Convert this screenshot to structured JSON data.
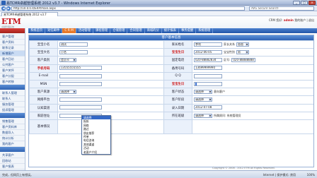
{
  "window": {
    "title": "易TCMR卓越管理系统 2012 v3.7 - Windows Internet Explorer",
    "buttons": [
      "_",
      "□",
      "×"
    ]
  },
  "browser": {
    "address": "http://10.0.0.4/ERP/main.aspx",
    "search_placeholder": "AVG Secure Search",
    "tab_label": "易TCMR卓越管理系统 2012 v3.7"
  },
  "app": {
    "logo": "ETM",
    "logo_sub": "卓越管理系统",
    "user_greeting": "CRM 您好:",
    "user_name": "admin",
    "user_links": "我的账户 | 退出"
  },
  "menu": [
    {
      "label": "系统首页",
      "active": false
    },
    {
      "label": "短信邮件",
      "active": false
    },
    {
      "label": "C R M",
      "active": true
    },
    {
      "label": "活动管理",
      "active": false
    },
    {
      "label": "课程管理",
      "active": false
    },
    {
      "label": "仓储管理",
      "active": false
    },
    {
      "label": "合同管理",
      "active": false
    },
    {
      "label": "商城的分",
      "active": false
    },
    {
      "label": "统计报表",
      "active": false
    },
    {
      "label": "事务提醒",
      "active": false
    },
    {
      "label": "系统管理",
      "active": false
    }
  ],
  "sidebar": {
    "items": [
      "客户管理",
      "客户资料",
      "联系记录",
      "新增客户",
      "客户回访",
      "公共客户",
      "客户关怀",
      "客户分配",
      "客户转移",
      "联系人管理",
      "联系人",
      "服务管理",
      "投诉管理",
      "销售管理",
      "客户资料库",
      "数据导入",
      "统计分析",
      "我的客户",
      "共享客户",
      "回收站",
      "客户报表",
      "客户设置",
      "设置"
    ]
  },
  "panel_title": "客户基本信息",
  "form": {
    "rows": [
      {
        "l1": "宝宝小名",
        "v1": "测试",
        "l2": "家长姓名",
        "v2": "李利",
        "v2_tail": "家长关系",
        "v2_sel": "爸爸"
      },
      {
        "l1": "宝宝大名",
        "v1": "小名",
        "l2": "宝宝生日",
        "v2": "2012-06-05",
        "v2_tail": "宝宝性别",
        "v2_sel": "男"
      },
      {
        "l1": "客户类别",
        "v1": "会员卡",
        "l2": "固定电话",
        "v2": "020-88882834",
        "v2_tail": "区号:",
        "v2_extra": "020-88888888"
      },
      {
        "l1": "手机号码",
        "v1": "13555555555",
        "l2": "备用号码",
        "v2": "13699999990"
      },
      {
        "l1": "E-mail",
        "v1": "",
        "l2": "Q Q",
        "v2": ""
      },
      {
        "l1": "MSN",
        "v1": "",
        "l2": "宝宝生日",
        "v2": ""
      },
      {
        "l1": "客户来源",
        "v1": "请选择",
        "l2": "客户状态",
        "v2": "请选择",
        "v2_tail": "意向客户"
      },
      {
        "l1": "网络平台",
        "v1": "",
        "l2": "客户阶段",
        "v2": "请选择"
      },
      {
        "l1": "认知渠道",
        "v1": "",
        "l2": "录入日期",
        "v2": "2012-07-08"
      },
      {
        "l1": "家庭住址",
        "v1": "",
        "l2": "所在班级",
        "v2": "请选择",
        "v2_tail": "所属顾问: 系统管理员"
      },
      {
        "l1": "基本情况",
        "v1": "",
        "l2": "",
        "v2": ""
      }
    ]
  },
  "dropdown": {
    "options": [
      "请选择",
      "报纸",
      "网络",
      "路过",
      "朋友推荐",
      "传单",
      "电话咨询",
      "其他渠道",
      "活动",
      "老客户介绍"
    ],
    "selected": 0
  },
  "statusbar": {
    "left": "完成，但网页上有错误。",
    "zone": "Internet | 保护模式: 禁用",
    "zoom": "100%"
  },
  "copyright": "Copyright © 2008 - 2012 ETM All Rights Reserved."
}
